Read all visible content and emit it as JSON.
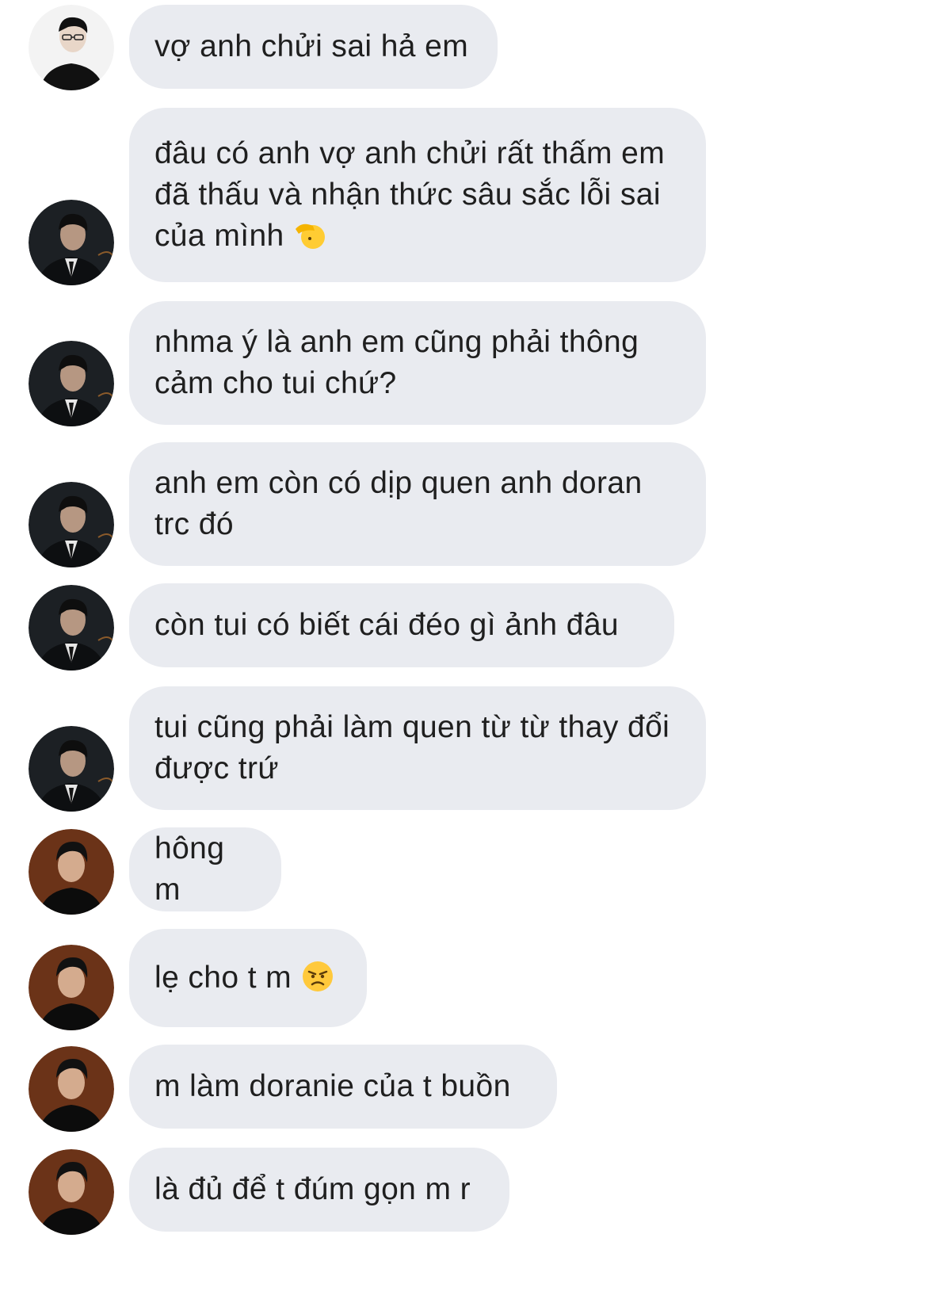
{
  "messages": [
    {
      "text": "vợ anh chửi sai hả em",
      "avatar": "avatar-white-bg-boy-glasses"
    },
    {
      "text": "đâu có anh vợ anh chửi rất thấm em đã thấu và nhận thức sâu sắc lỗi sai của mình",
      "emoji": "saluting-face-icon",
      "avatar": "avatar-dark-suit"
    },
    {
      "text": "nhma ý là anh em cũng phải thông cảm cho tui chứ?",
      "avatar": "avatar-dark-suit"
    },
    {
      "text": "anh em còn có dịp quen anh doran trc đó",
      "avatar": "avatar-dark-suit"
    },
    {
      "text": "còn tui có biết cái đéo gì ảnh đâu",
      "avatar": "avatar-dark-suit"
    },
    {
      "text": "tui cũng phải làm quen từ từ thay đổi được trứ",
      "avatar": "avatar-dark-suit"
    },
    {
      "text": "hông m",
      "avatar": "avatar-brown-bg"
    },
    {
      "text": "lẹ cho t m",
      "emoji": "angry-face-icon",
      "avatar": "avatar-brown-bg"
    },
    {
      "text": "m làm doranie của t buồn",
      "avatar": "avatar-brown-bg"
    },
    {
      "text": "là đủ để t đúm gọn m r",
      "avatar": "avatar-brown-bg"
    }
  ],
  "colors": {
    "bubble": "#e9ebf0",
    "text": "#1f1f1f",
    "background": "#ffffff"
  }
}
